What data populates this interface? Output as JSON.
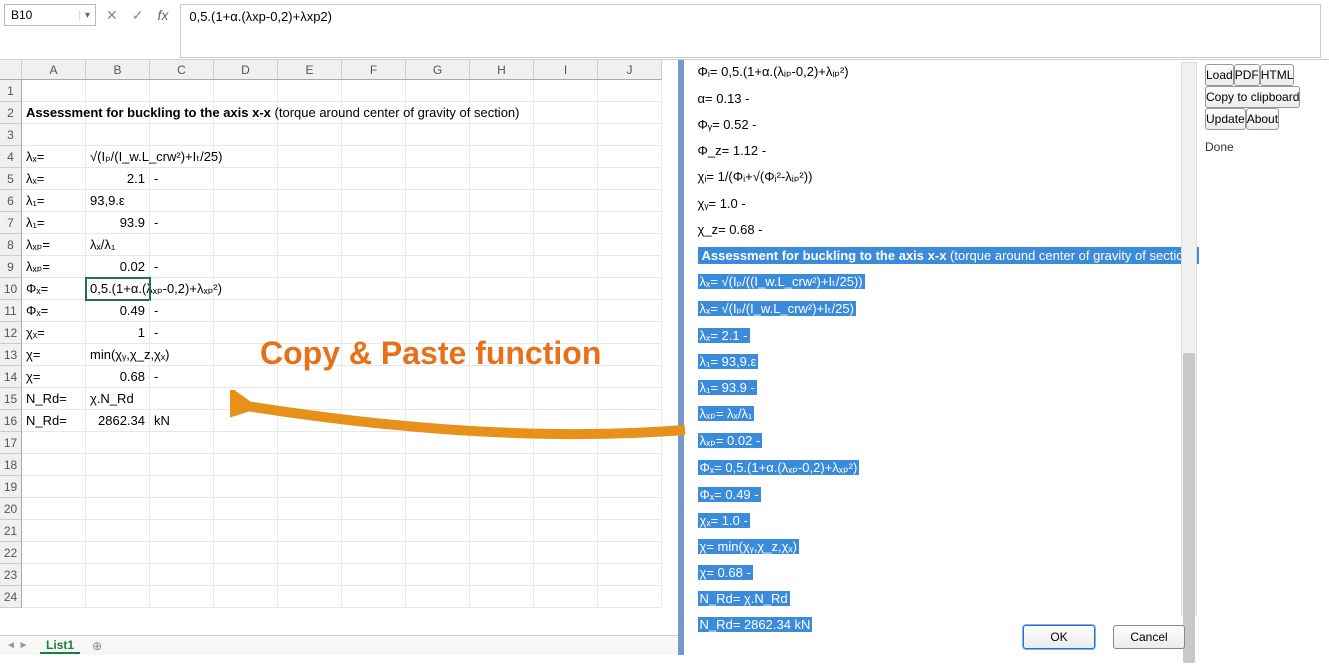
{
  "nameBox": "B10",
  "formula": "0,5.(1+α.(λxp-0,2)+λxp2)",
  "columns": [
    "A",
    "B",
    "C",
    "D",
    "E",
    "F",
    "G",
    "H",
    "I",
    "J"
  ],
  "rows": [
    {
      "n": 1,
      "A": "",
      "B": "",
      "C": ""
    },
    {
      "n": 2,
      "A": "Assessment for buckling to the axis x-x (torque around center of gravity of section)",
      "bold": true
    },
    {
      "n": 3,
      "A": "",
      "B": "",
      "C": ""
    },
    {
      "n": 4,
      "A": "λₓ=",
      "B": "√(Iₚ/(I_w.L_crw²)+Iₜ/25)"
    },
    {
      "n": 5,
      "A": "λₓ=",
      "B": "2.1",
      "C": "-"
    },
    {
      "n": 6,
      "A": "λ₁=",
      "B": "93,9.ε"
    },
    {
      "n": 7,
      "A": "λ₁=",
      "B": "93.9",
      "C": "-"
    },
    {
      "n": 8,
      "A": "λₓₚ=",
      "B": "λₓ/λ₁"
    },
    {
      "n": 9,
      "A": "λₓₚ=",
      "B": "0.02",
      "C": "-"
    },
    {
      "n": 10,
      "A": "Φₓ=",
      "B": "0,5.(1+α.(λₓₚ-0,2)+λₓₚ²)",
      "sel": true
    },
    {
      "n": 11,
      "A": "Φₓ=",
      "B": "0.49",
      "C": "-"
    },
    {
      "n": 12,
      "A": "χₓ=",
      "B": "1",
      "C": "-"
    },
    {
      "n": 13,
      "A": "χ=",
      "B": "min(χᵧ,χ_z,χₓ)"
    },
    {
      "n": 14,
      "A": "χ=",
      "B": "0.68",
      "C": "-"
    },
    {
      "n": 15,
      "A": "N_Rd=",
      "B": "χ.N_Rd"
    },
    {
      "n": 16,
      "A": "N_Rd=",
      "B": "2862.34",
      "C": "kN"
    },
    {
      "n": 17
    },
    {
      "n": 18
    },
    {
      "n": 19
    },
    {
      "n": 20
    },
    {
      "n": 21
    },
    {
      "n": 22
    },
    {
      "n": 23
    },
    {
      "n": 24
    }
  ],
  "sheetTab": "List1",
  "annotation": "Copy & Paste function",
  "rightLines": [
    {
      "t": "Φᵢ= 0,5.(1+α.(λᵢₚ-0,2)+λᵢₚ²)",
      "hl": false
    },
    {
      "t": "α= 0.13 -",
      "hl": false
    },
    {
      "t": "Φᵧ= 0.52 -",
      "hl": false
    },
    {
      "t": "Φ_z= 1.12 -",
      "hl": false
    },
    {
      "t": "χᵢ= 1/(Φᵢ+√(Φᵢ²-λᵢₚ²))",
      "hl": false
    },
    {
      "t": "χᵧ= 1.0 -",
      "hl": false
    },
    {
      "t": "χ_z= 0.68 -",
      "hl": false
    }
  ],
  "rightHeader": {
    "bold": "Assessment for buckling to the axis x-x",
    "rest": " (torque around center of gravity of section)"
  },
  "rightHL": [
    "λₓ= √(Iₚ/((I_w.L_crw²)+Iₜ/25))",
    "λₓ= √(Iₚ/(I_w.L_crw²)+Iₜ/25)",
    "λₓ= 2.1 -",
    "λ₁= 93,9.ε",
    "λ₁= 93.9 -",
    "λₓₚ= λₓ/λ₁",
    "λₓₚ= 0.02 -",
    "Φₓ= 0,5.(1+α.(λₓₚ-0,2)+λₓₚ²)",
    "Φₓ= 0.49 -",
    "χₓ= 1.0 -",
    "χ= min(χᵧ,χ_z,χₓ)",
    "χ= 0.68 -",
    "N_Rd= χ.N_Rd",
    "N_Rd= 2862.34 kN"
  ],
  "sideButtons": [
    "Load",
    "PDF",
    "HTML",
    "Copy to clipboard",
    "Update",
    "About"
  ],
  "sideStatus": "Done",
  "dlg": {
    "ok": "OK",
    "cancel": "Cancel"
  }
}
